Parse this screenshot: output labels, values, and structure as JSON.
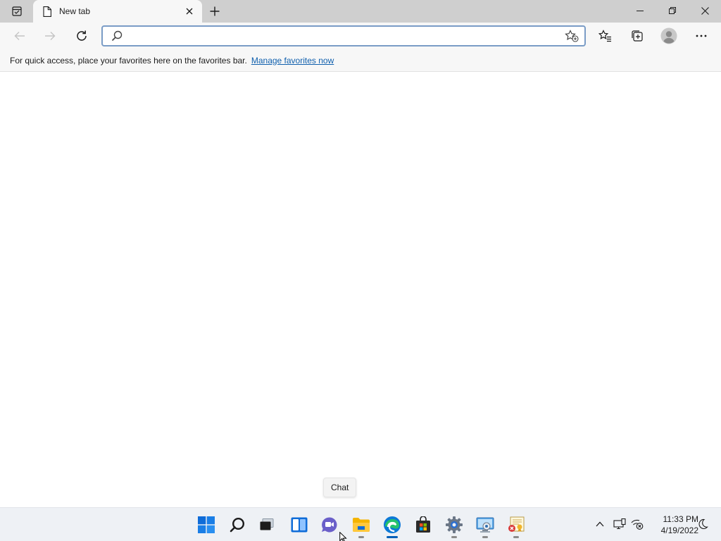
{
  "browser": {
    "tab": {
      "title": "New tab"
    },
    "address_bar": {
      "value": "",
      "placeholder": ""
    },
    "favorites_bar": {
      "message": "For quick access, place your favorites here on the favorites bar.",
      "link_label": "Manage favorites now"
    }
  },
  "tooltip": {
    "text": "Chat"
  },
  "taskbar": {
    "pinned": [
      {
        "name": "start-icon"
      },
      {
        "name": "search-icon"
      },
      {
        "name": "task-view-icon"
      },
      {
        "name": "widgets-icon"
      },
      {
        "name": "chat-icon"
      },
      {
        "name": "file-explorer-icon"
      },
      {
        "name": "edge-icon"
      },
      {
        "name": "store-icon"
      },
      {
        "name": "settings-icon"
      },
      {
        "name": "remote-desktop-icon"
      },
      {
        "name": "certificate-manager-icon"
      }
    ],
    "clock": {
      "time": "11:33 PM",
      "date": "4/19/2022"
    }
  },
  "colors": {
    "accent": "#005fb8",
    "link": "#0f5fad",
    "tabstrip": "#cfcfcf",
    "toolbar": "#f7f7f7"
  }
}
